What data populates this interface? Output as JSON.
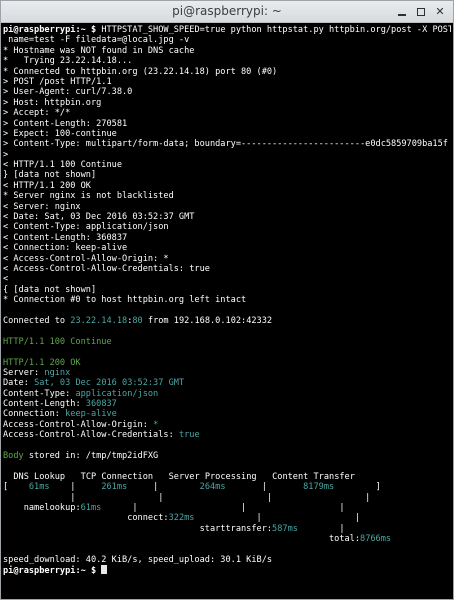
{
  "window": {
    "title": "pi@raspberrypi: ~"
  },
  "prompt": {
    "user_host": "pi@raspberrypi",
    "path_symbol": ":~ $",
    "command_line1": " HTTPSTAT_SHOW_SPEED=true python httpstat.py httpbin.org/post -X POST -F",
    "command_line2": " name=test -F filedata=@local.jpg -v"
  },
  "verbose": {
    "lines": [
      "* Hostname was NOT found in DNS cache",
      "*   Trying 23.22.14.18...",
      "* Connected to httpbin.org (23.22.14.18) port 80 (#0)",
      "> POST /post HTTP/1.1",
      "> User-Agent: curl/7.38.0",
      "> Host: httpbin.org",
      "> Accept: */*",
      "> Content-Length: 270581",
      "> Expect: 100-continue",
      "> Content-Type: multipart/form-data; boundary=------------------------e0dc5859709ba15f",
      ">",
      "< HTTP/1.1 100 Continue",
      "} [data not shown]",
      "< HTTP/1.1 200 OK",
      "* Server nginx is not blacklisted",
      "< Server: nginx",
      "< Date: Sat, 03 Dec 2016 03:52:37 GMT",
      "< Content-Type: application/json",
      "< Content-Length: 360837",
      "< Connection: keep-alive",
      "< Access-Control-Allow-Origin: *",
      "< Access-Control-Allow-Credentials: true",
      "<",
      "{ [data not shown]",
      "* Connection #0 to host httpbin.org left intact"
    ]
  },
  "connected": {
    "prefix": "Connected to ",
    "ip": "23.22.14.18",
    "colon": ":",
    "port": "80",
    "from_text": " from 192.168.0.102:42332"
  },
  "continue_status": "HTTP/1.1 100 Continue",
  "ok_status": "HTTP/1.1 200 OK",
  "headers": [
    {
      "name": "Server",
      "value": "nginx"
    },
    {
      "name": "Date",
      "value": "Sat, 03 Dec 2016 03:52:37 GMT"
    },
    {
      "name": "Content-Type",
      "value": "application/json"
    },
    {
      "name": "Content-Length",
      "value": "360837"
    },
    {
      "name": "Connection",
      "value": "keep-alive"
    },
    {
      "name": "Access-Control-Allow-Origin",
      "value": "*"
    },
    {
      "name": "Access-Control-Allow-Credentials",
      "value": "true"
    }
  ],
  "body": {
    "word": "Body",
    "rest": " stored in: /tmp/tmp2idFXG"
  },
  "timing": {
    "columns": [
      "DNS Lookup",
      "TCP Connection",
      "Server Processing",
      "Content Transfer"
    ],
    "values": [
      "61ms",
      "261ms",
      "264ms",
      "8179ms"
    ],
    "namelookup": {
      "label": "namelookup:",
      "value": "61ms"
    },
    "connect": {
      "label": "connect:",
      "value": "322ms"
    },
    "starttransfer": {
      "label": "starttransfer:",
      "value": "587ms"
    },
    "total": {
      "label": "total:",
      "value": "8766ms"
    }
  },
  "speed": "speed_download: 40.2 KiB/s, speed_upload: 30.1 KiB/s",
  "final_prompt": {
    "user_host": "pi@raspberrypi",
    "path_symbol": ":~ $"
  },
  "colors": {
    "green": "#5fa64a",
    "teal": "#4aa7a4",
    "background": "#000000",
    "text": "#d7d7d7"
  }
}
